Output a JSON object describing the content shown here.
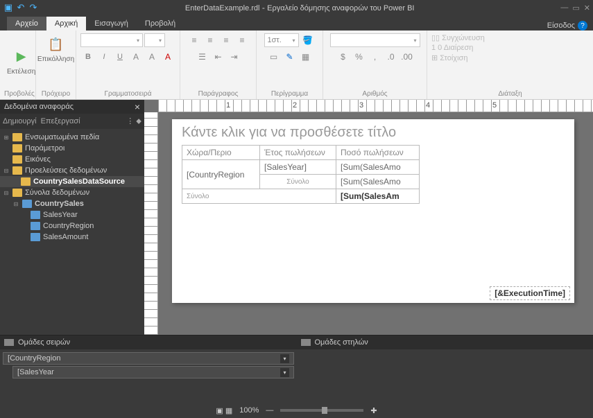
{
  "title": {
    "file": "EnterDataExample.rdl",
    "app": "Εργαλείο δόμησης αναφορών του Power BI"
  },
  "tabs": {
    "file": "Αρχείο",
    "home": "Αρχική",
    "insert": "Εισαγωγή",
    "view": "Προβολή"
  },
  "signin": "Είσοδος",
  "rib": {
    "run": "Εκτέλεση",
    "views": "Προβολές",
    "paste": "Επικόλληση",
    "clipboard": "Πρόχειρο",
    "font": "Γραμματοσειρά",
    "para": "Παράγραφος",
    "border_w": "1στ.",
    "border": "Περίγραμμα",
    "number": "Αριθμός",
    "merge": "Συγχώνευση",
    "split": "Διαίρεση",
    "align": "Στοίχιση",
    "layout": "Διάταξη"
  },
  "sb": {
    "title": "Δεδομένα αναφοράς",
    "new": "Δημιουργί",
    "edit": "Επεξεργασί",
    "builtin": "Ενσωματωμένα πεδία",
    "params": "Παράμετροι",
    "images": "Εικόνες",
    "datasources": "Προελεύσεις δεδομένων",
    "ds": "CountrySalesDataSource",
    "datasets": "Σύνολα δεδομένων",
    "dset": "CountrySales",
    "f1": "SalesYear",
    "f2": "CountryRegion",
    "f3": "SalesAmount"
  },
  "report": {
    "title_ph": "Κάντε κλικ για να προσθέσετε τίτλο",
    "h1": "Χώρα/Περιο",
    "h2": "Έτος πωλήσεων",
    "h3": "Ποσό πωλήσεων",
    "r1c1": "[CountryRegion",
    "r1c2": "[SalesYear]",
    "r1c3": "[Sum(SalesAmo",
    "subtotal": "Σύνολο",
    "r2c3": "[Sum(SalesAmo",
    "total": "Σύνολο",
    "r3c3": "[Sum(SalesAm",
    "exec": "[&ExecutionTime]"
  },
  "groups": {
    "rows": "Ομάδες σειρών",
    "cols": "Ομάδες στηλών",
    "g1": "CountryRegion",
    "g2": "SalesYear"
  },
  "status": {
    "zoom": "100%"
  },
  "ruler": [
    "1",
    "2",
    "3",
    "4",
    "5"
  ]
}
